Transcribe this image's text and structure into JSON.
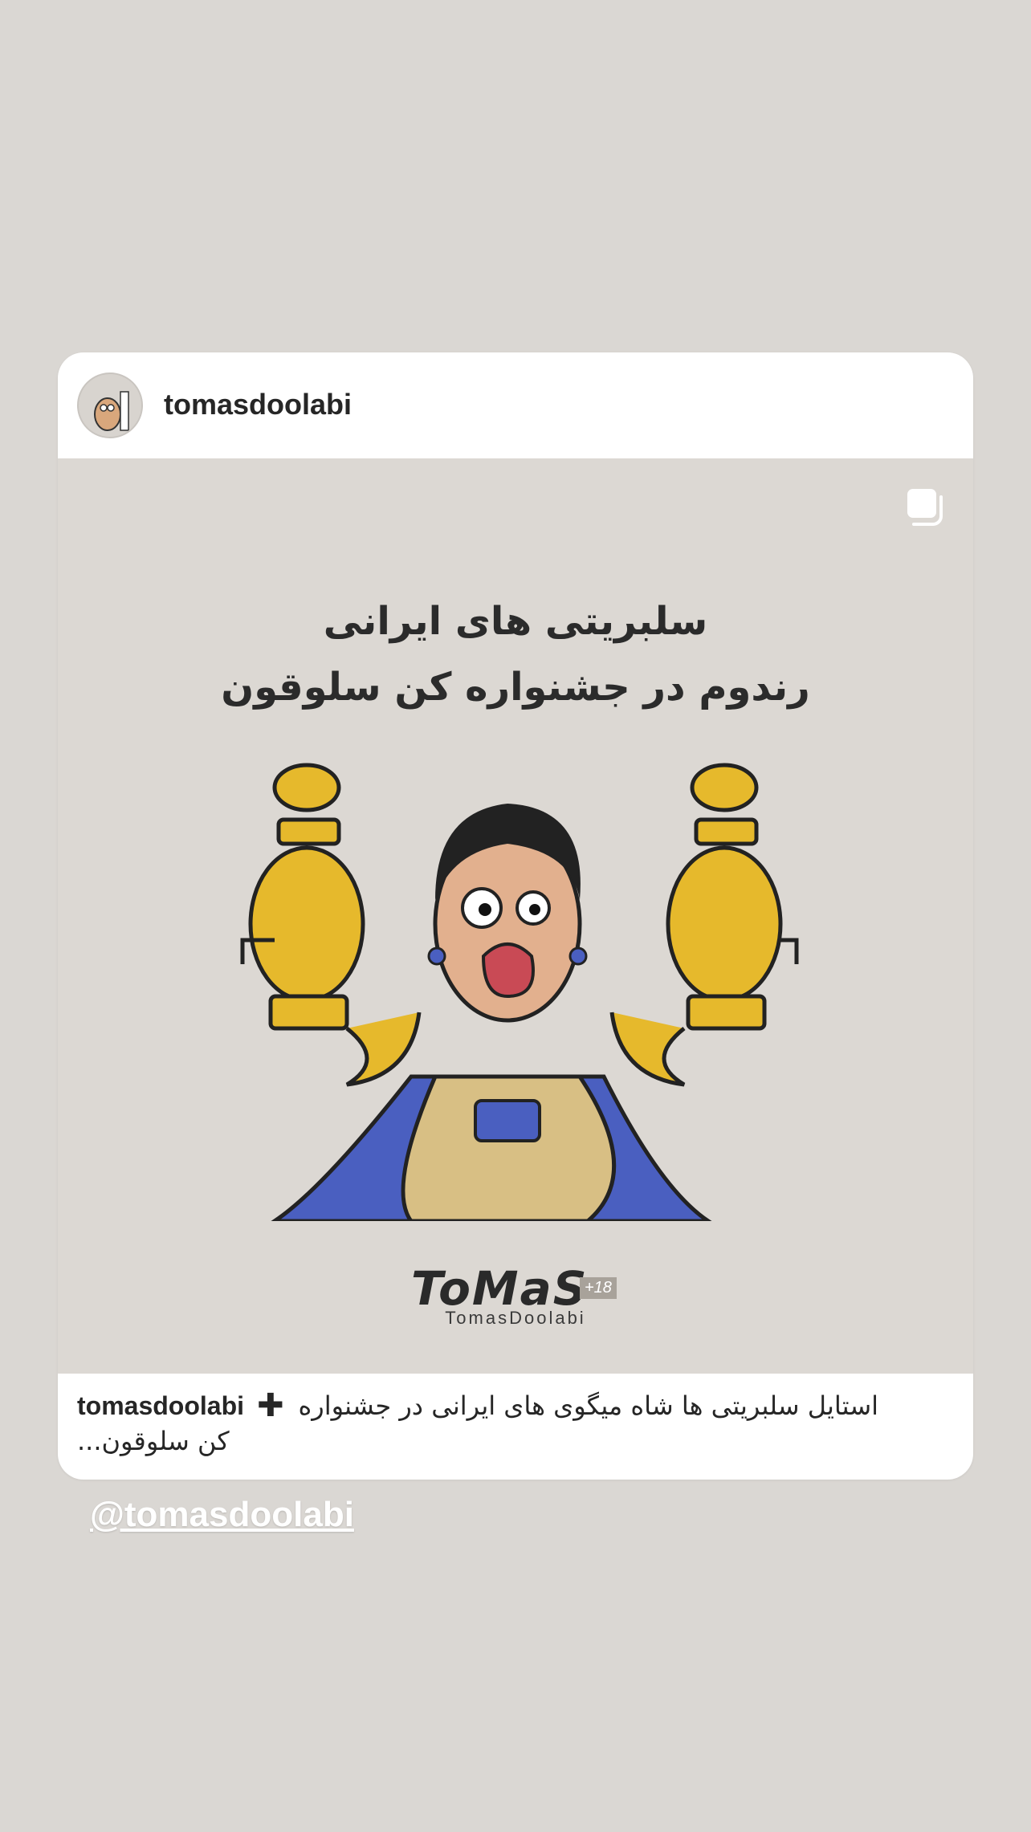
{
  "post": {
    "username": "tomasdoolabi",
    "image_title_line1": "سلبریتی های ایرانی",
    "image_title_line2": "رندوم در جشنواره کن سلوقون",
    "watermark_logo": "ToMaS",
    "watermark_age": "+18",
    "watermark_sub": "TomasDoolabi",
    "caption_username": "tomasdoolabi",
    "caption_plus": "✚",
    "caption_line1": "استایل سلبریتی ها شاه میگوی های ایرانی در جشنواره",
    "caption_line2": "کن سلوقون..."
  },
  "mention": "@tomasdoolabi",
  "icons": {
    "multi_post": "multi-image-icon",
    "avatar": "avatar-image"
  },
  "colors": {
    "background": "#dad7d3",
    "card": "#ffffff",
    "text": "#262626"
  }
}
